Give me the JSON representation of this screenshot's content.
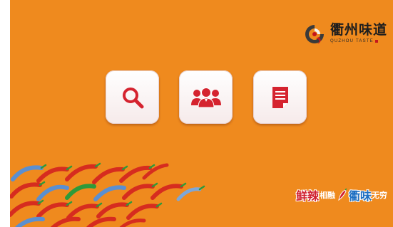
{
  "brand": {
    "title": "衢州味道",
    "subtitle": "QUZHOU TASTE",
    "logo_icon": "swirl-logo-icon"
  },
  "actions": [
    {
      "name": "search",
      "icon": "search-icon",
      "color": "#d5232f"
    },
    {
      "name": "users",
      "icon": "users-icon",
      "color": "#d5232f"
    },
    {
      "name": "document",
      "icon": "document-icon",
      "color": "#d5232f"
    }
  ],
  "slogan": {
    "part1": "鲜辣",
    "part2": "相融",
    "part3": "衢",
    "part4": "味",
    "part5": "无穷"
  },
  "colors": {
    "background": "#ef8a1e",
    "accent_red": "#d5232f",
    "accent_blue": "#1d6fc2",
    "card": "#ffffff"
  }
}
